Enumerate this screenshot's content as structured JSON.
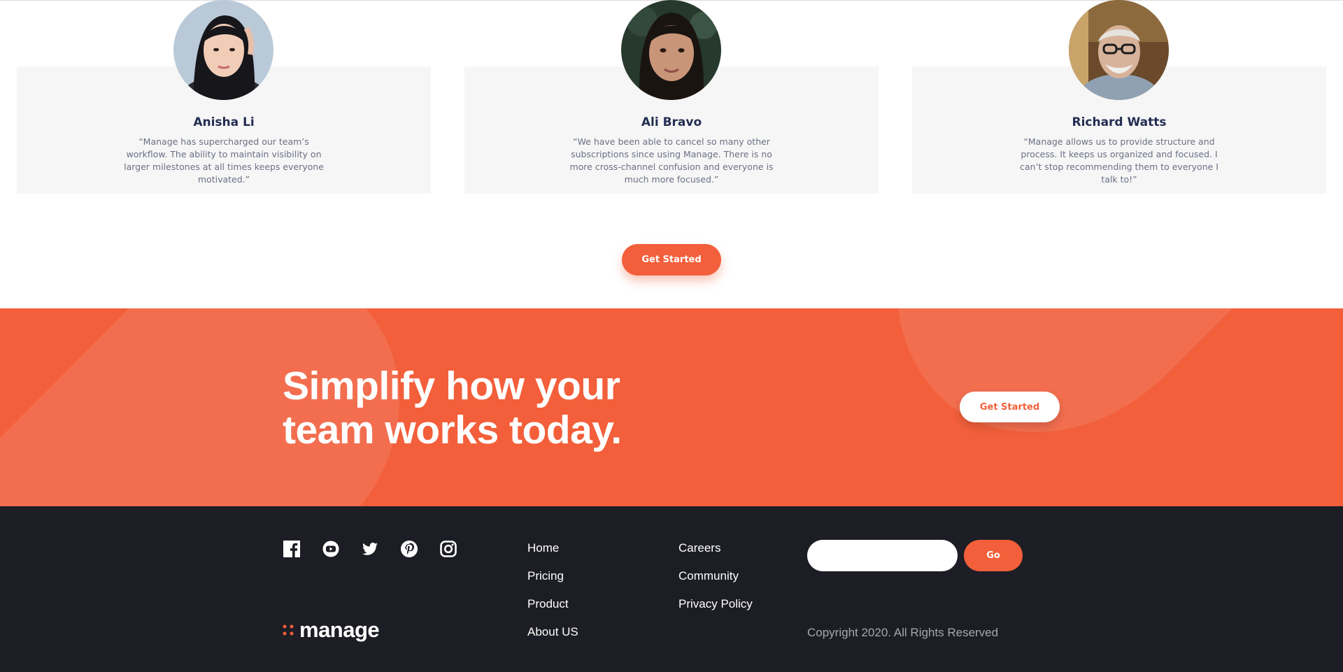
{
  "testimonials": [
    {
      "name": "Anisha Li",
      "quote": "“Manage has supercharged our team’s workflow. The ability to maintain visibility on larger milestones at all times keeps everyone motivated.”",
      "avatar_icon": "avatar-woman-icon"
    },
    {
      "name": "Ali Bravo",
      "quote": "“We have been able to cancel so many other subscriptions since using Manage. There is no more cross-channel confusion and everyone is much more focused.”",
      "avatar_icon": "avatar-woman-icon"
    },
    {
      "name": "Richard Watts",
      "quote": "“Manage allows us to provide structure and process. It keeps us organized and focused. I can’t stop recommending them to everyone I talk to!”",
      "avatar_icon": "avatar-man-icon"
    }
  ],
  "testimonials_cta": "Get Started",
  "cta_band": {
    "heading": "Simplify how your team works today.",
    "button": "Get Started"
  },
  "footer": {
    "social_icons": [
      "facebook-icon",
      "youtube-icon",
      "twitter-icon",
      "pinterest-icon",
      "instagram-icon"
    ],
    "links_col1": [
      "Home",
      "Pricing",
      "Product",
      "About US"
    ],
    "links_col2": [
      "Careers",
      "Community",
      "Privacy Policy"
    ],
    "email_placeholder": "",
    "go_label": "Go",
    "copyright": "Copyright 2020. All Rights Reserved",
    "logo_text": "manage"
  },
  "colors": {
    "accent": "#f25f3a",
    "dark": "#1d1e25",
    "heading": "#242d52",
    "card_bg": "#f6f6f6"
  }
}
